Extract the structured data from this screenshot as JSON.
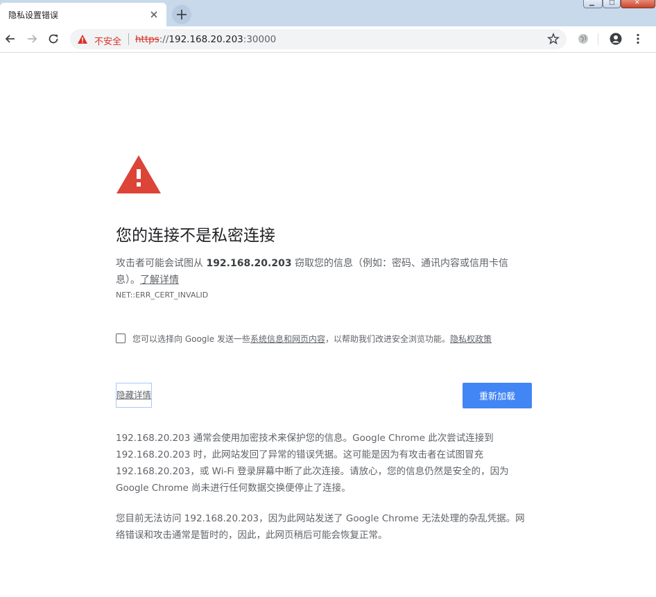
{
  "tab": {
    "title": "隐私设置错误"
  },
  "window": {
    "min_icon": "minimize-icon",
    "max_icon": "maximize-icon",
    "close_icon": "close-icon"
  },
  "toolbar": {
    "back_icon": "back-arrow-icon",
    "forward_icon": "forward-arrow-icon",
    "reload_icon": "reload-icon",
    "insecure_label": "不安全",
    "url_scheme": "https",
    "url_separator": "://",
    "url_host": "192.168.20.203",
    "url_port": ":30000",
    "bookmark_icon": "star-icon",
    "extension_icon": "globe-icon",
    "profile_icon": "account-icon",
    "menu_icon": "more-vert-icon"
  },
  "interstitial": {
    "heading": "您的连接不是私密连接",
    "intro_before": "攻击者可能会试图从 ",
    "intro_host": "192.168.20.203",
    "intro_after": " 窃取您的信息（例如：密码、通讯内容或信用卡信息）。",
    "learn_more": "了解详情",
    "error_code": "NET::ERR_CERT_INVALID",
    "optin_before": "您可以选择向 Google 发送一些",
    "optin_link": "系统信息和网页内容",
    "optin_after": "，以帮助我们改进安全浏览功能。",
    "privacy_link": "隐私权政策",
    "hide_details": "隐藏详情",
    "reload": "重新加载",
    "details_p1": "192.168.20.203 通常会使用加密技术来保护您的信息。Google Chrome 此次尝试连接到 192.168.20.203 时，此网站发回了异常的错误凭据。这可能是因为有攻击者在试图冒充 192.168.20.203，或 Wi-Fi 登录屏幕中断了此次连接。请放心，您的信息仍然是安全的，因为 Google Chrome 尚未进行任何数据交换便停止了连接。",
    "details_p2": "您目前无法访问 192.168.20.203，因为此网站发送了 Google Chrome 无法处理的杂乱凭据。网络错误和攻击通常是暂时的，因此，此网页稍后可能会恢复正常。"
  },
  "colors": {
    "warning_red": "#db4437",
    "link_blue_button": "#4285f4",
    "insecure_red": "#d93025",
    "text_gray": "#5f6368"
  }
}
